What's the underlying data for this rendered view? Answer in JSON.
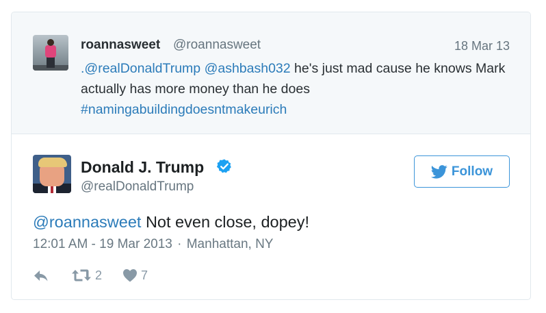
{
  "parent_tweet": {
    "name": "roannasweet",
    "handle": "@roannasweet",
    "date": "18 Mar 13",
    "text_mention_1": ".@realDonaldTrump",
    "text_mention_2": "@ashbash032",
    "text_body": " he's just mad cause he knows Mark actually has more money than he does",
    "hashtag": "#namingabuildingdoesntmakeurich"
  },
  "tweet": {
    "name": "Donald J. Trump",
    "handle": "@realDonaldTrump",
    "verified": true,
    "follow_label": "Follow",
    "reply_to": "@roannasweet",
    "text": " Not even close, dopey!",
    "timestamp": "12:01 AM - 19 Mar 2013",
    "separator": "·",
    "location": "Manhattan, NY",
    "retweet_count": "2",
    "like_count": "7"
  },
  "colors": {
    "link": "#2b7bb9",
    "follow_accent": "#3b94d9",
    "verified": "#1da1f2",
    "parent_bg": "#f5f8fa",
    "border": "#e1e8ed"
  },
  "icons": [
    "reply-icon",
    "retweet-icon",
    "heart-icon",
    "twitter-bird-icon",
    "verified-badge-icon"
  ]
}
